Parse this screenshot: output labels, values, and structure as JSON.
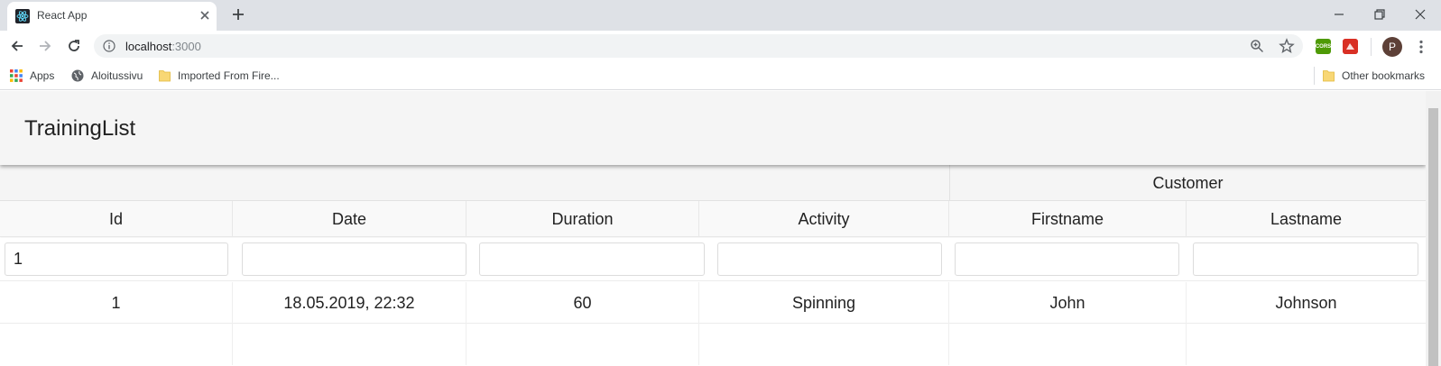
{
  "browser": {
    "tab_title": "React App",
    "url_host": "localhost",
    "url_port": ":3000",
    "profile_initial": "P",
    "extensions": {
      "cors_label": "CORS"
    },
    "bookmarks": {
      "apps": "Apps",
      "aloitussivu": "Aloitussivu",
      "imported": "Imported From Fire...",
      "other": "Other bookmarks"
    }
  },
  "app": {
    "title": "TrainingList"
  },
  "table": {
    "group_header": "Customer",
    "columns": [
      "Id",
      "Date",
      "Duration",
      "Activity",
      "Firstname",
      "Lastname"
    ],
    "filters": [
      "1",
      "",
      "",
      "",
      "",
      ""
    ],
    "rows": [
      [
        "1",
        "18.05.2019, 22:32",
        "60",
        "Spinning",
        "John",
        "Johnson"
      ],
      [
        "",
        "",
        "",
        "",
        "",
        ""
      ]
    ]
  }
}
